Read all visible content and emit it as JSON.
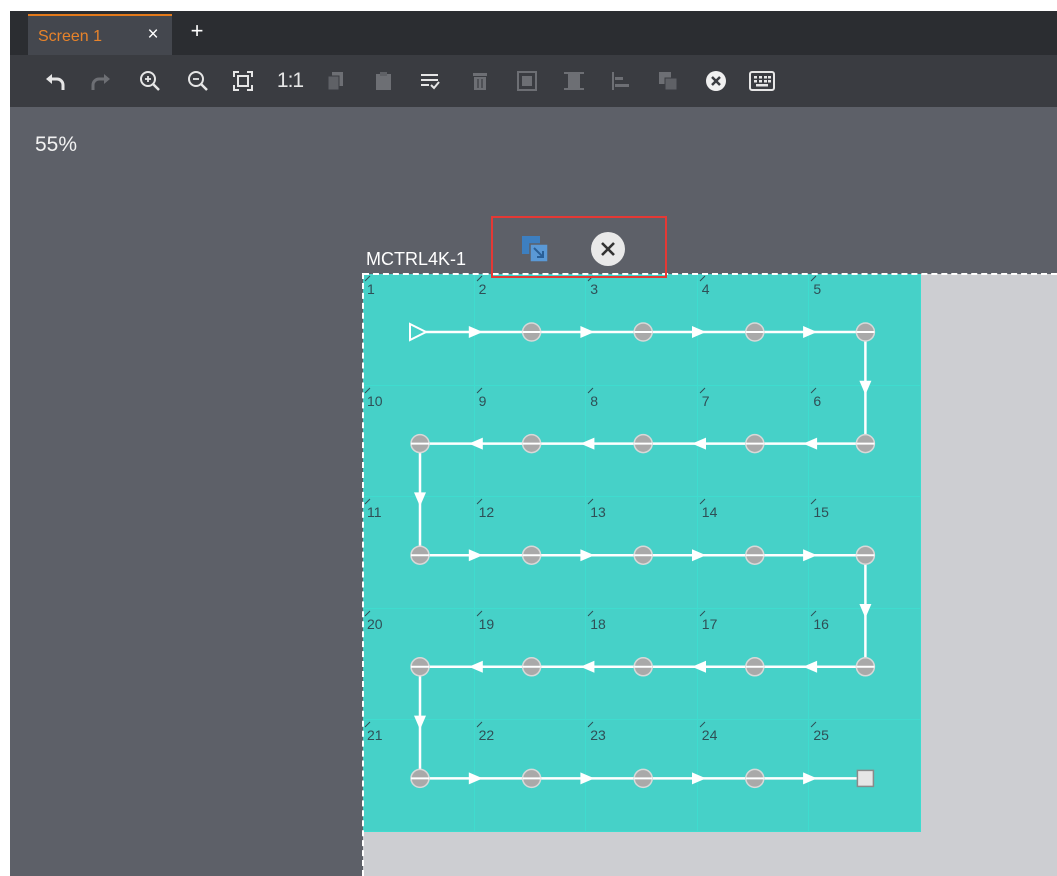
{
  "tabs": [
    {
      "label": "Screen 1",
      "close_glyph": "×",
      "active": true
    }
  ],
  "add_tab_glyph": "+",
  "toolbar": {
    "items": [
      {
        "name": "undo-button",
        "icon": "undo-icon",
        "enabled": true
      },
      {
        "name": "redo-button",
        "icon": "redo-icon",
        "enabled": false
      },
      {
        "name": "zoom-in-button",
        "icon": "zoom-in-icon",
        "enabled": true
      },
      {
        "name": "zoom-out-button",
        "icon": "zoom-out-icon",
        "enabled": true
      },
      {
        "name": "fit-screen-button",
        "icon": "fit-screen-icon",
        "enabled": true
      },
      {
        "name": "actual-size-button",
        "icon": "actual-size-icon",
        "label": "1:1",
        "enabled": true
      },
      {
        "name": "copy-button",
        "icon": "copy-icon",
        "enabled": false
      },
      {
        "name": "paste-button",
        "icon": "paste-icon",
        "enabled": false
      },
      {
        "name": "select-all-button",
        "icon": "select-all-icon",
        "enabled": true
      },
      {
        "name": "delete-button",
        "icon": "trash-icon",
        "enabled": false
      },
      {
        "name": "align-fill-button",
        "icon": "align-fill-icon",
        "enabled": false
      },
      {
        "name": "align-center-button",
        "icon": "align-center-icon",
        "enabled": false
      },
      {
        "name": "align-left-button",
        "icon": "align-left-icon",
        "enabled": false
      },
      {
        "name": "copy-connection-button",
        "icon": "copy-connection-icon",
        "enabled": false
      },
      {
        "name": "clear-button",
        "icon": "clear-icon",
        "enabled": true
      },
      {
        "name": "keyboard-button",
        "icon": "keyboard-icon",
        "enabled": true
      }
    ]
  },
  "zoom_level": "55%",
  "controller": {
    "label": "MCTRL4K-1",
    "copy_action_icon": "copy-connection-icon",
    "close_action_icon": "close-icon"
  },
  "cabinets": {
    "rows": [
      [
        "1",
        "2",
        "3",
        "4",
        "5"
      ],
      [
        "10",
        "9",
        "8",
        "7",
        "6"
      ],
      [
        "11",
        "12",
        "13",
        "14",
        "15"
      ],
      [
        "20",
        "19",
        "18",
        "17",
        "16"
      ],
      [
        "21",
        "22",
        "23",
        "24",
        "25"
      ]
    ]
  },
  "colors": {
    "accent": "#e8832a",
    "cabinet_fill": "#46d1c8",
    "canvas_bg": "#5d6068",
    "highlight": "#e53935"
  }
}
